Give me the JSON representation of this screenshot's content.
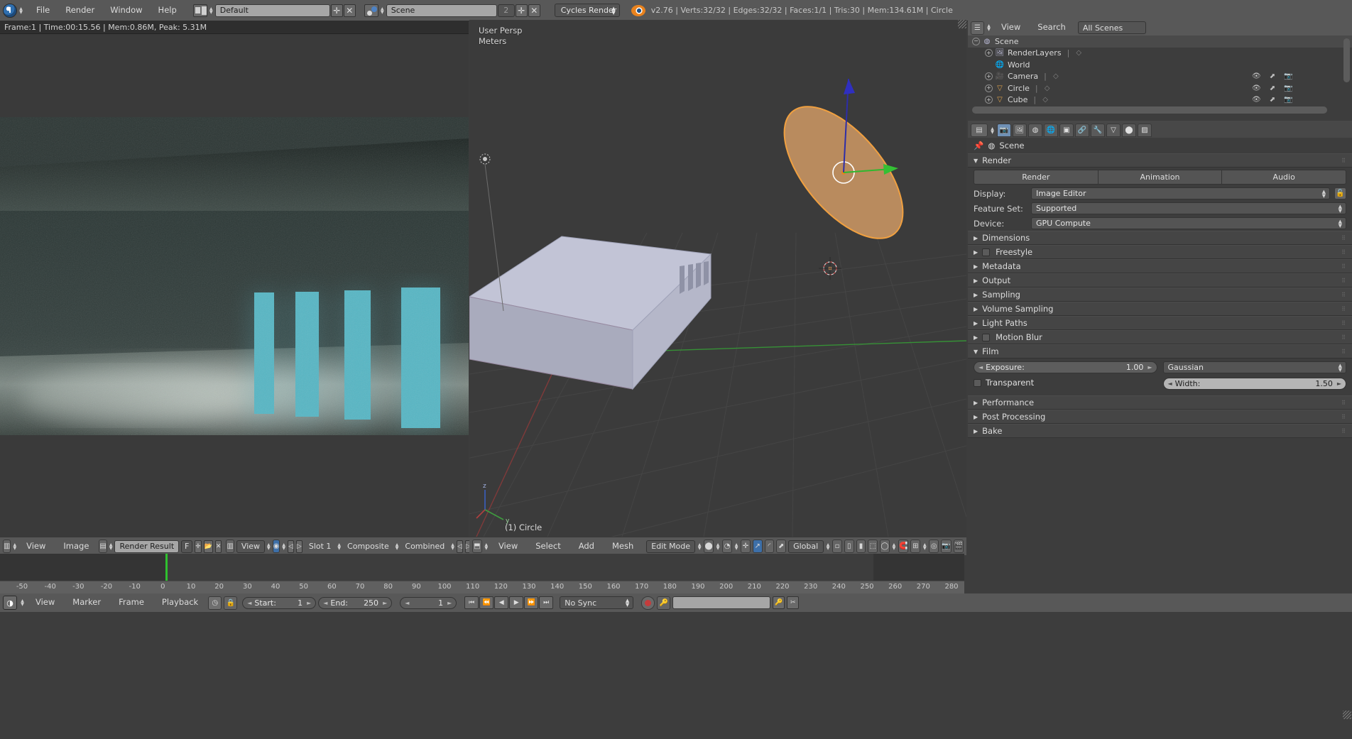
{
  "topbar": {
    "app_icon": "blender-info-icon",
    "menus": [
      "File",
      "Render",
      "Window",
      "Help"
    ],
    "screen_layout": "Default",
    "scene_name": "Scene",
    "scene_users": "2",
    "render_engine": "Cycles Render",
    "status": "v2.76 | Verts:32/32 | Edges:32/32 | Faces:1/1 | Tris:30 | Mem:134.61M | Circle"
  },
  "info_editor": {
    "report": "Frame:1 | Time:00:15.56 | Mem:0.86M, Peak: 5.31M"
  },
  "viewport": {
    "view_name": "User Persp",
    "unit": "Meters",
    "active_object": "(1) Circle",
    "axis_x": "x",
    "axis_y": "y",
    "axis_z": "z"
  },
  "image_editor_header": {
    "menus": [
      "View",
      "Image"
    ],
    "image_name": "Render Result",
    "fake_user": "F",
    "add_label": "+",
    "view_menu": "View",
    "slot": "Slot 1",
    "layer": "Composite",
    "pass": "Combined"
  },
  "viewport_header": {
    "menus": [
      "View",
      "Select",
      "Add",
      "Mesh"
    ],
    "mode": "Edit Mode",
    "transform_orientation": "Global"
  },
  "outliner": {
    "menus": [
      "View",
      "Search"
    ],
    "display_mode": "All Scenes",
    "rows": [
      {
        "label": "Scene",
        "indent": 0,
        "expander": "−",
        "icon": "scene-icon",
        "selected": true,
        "has_restrict": false
      },
      {
        "label": "RenderLayers",
        "indent": 1,
        "expander": "+",
        "icon": "renderlayers-icon",
        "selected": false,
        "has_restrict": false
      },
      {
        "label": "World",
        "indent": 1,
        "expander": "",
        "icon": "world-icon",
        "selected": false,
        "has_restrict": false
      },
      {
        "label": "Camera",
        "indent": 1,
        "expander": "+",
        "icon": "camera-icon",
        "selected": false,
        "has_restrict": true
      },
      {
        "label": "Circle",
        "indent": 1,
        "expander": "+",
        "icon": "mesh-icon",
        "selected": false,
        "has_restrict": true
      },
      {
        "label": "Cube",
        "indent": 1,
        "expander": "+",
        "icon": "mesh-icon",
        "selected": false,
        "has_restrict": true
      }
    ]
  },
  "properties": {
    "tabs": [
      "render",
      "renderlayers",
      "scene",
      "world",
      "object",
      "constraints",
      "modifiers",
      "data",
      "material",
      "texture"
    ],
    "active_tab": "render",
    "breadcrumb": "Scene",
    "render_panel": {
      "title": "Render",
      "buttons": [
        "Render",
        "Animation",
        "Audio"
      ],
      "fields": [
        {
          "label": "Display:",
          "value": "Image Editor"
        },
        {
          "label": "Feature Set:",
          "value": "Supported"
        },
        {
          "label": "Device:",
          "value": "GPU Compute"
        }
      ]
    },
    "panels": [
      {
        "title": "Dimensions",
        "open": false,
        "checkbox": false
      },
      {
        "title": "Freestyle",
        "open": false,
        "checkbox": true
      },
      {
        "title": "Metadata",
        "open": false,
        "checkbox": false
      },
      {
        "title": "Output",
        "open": false,
        "checkbox": false
      },
      {
        "title": "Sampling",
        "open": false,
        "checkbox": false
      },
      {
        "title": "Volume Sampling",
        "open": false,
        "checkbox": false
      },
      {
        "title": "Light Paths",
        "open": false,
        "checkbox": false
      },
      {
        "title": "Motion Blur",
        "open": false,
        "checkbox": true
      }
    ],
    "film_panel": {
      "title": "Film",
      "exposure_label": "Exposure:",
      "exposure_value": "1.00",
      "transparent_label": "Transparent",
      "filter_type": "Gaussian",
      "width_label": "Width:",
      "width_value": "1.50"
    },
    "trailing_panels": [
      {
        "title": "Performance"
      },
      {
        "title": "Post Processing"
      },
      {
        "title": "Bake"
      }
    ]
  },
  "timeline": {
    "menus": [
      "View",
      "Marker",
      "Frame",
      "Playback"
    ],
    "start_label": "Start:",
    "start_value": "1",
    "end_label": "End:",
    "end_value": "250",
    "current_frame": "1",
    "sync_mode": "No Sync",
    "ticks": [
      "-50",
      "-40",
      "-30",
      "-20",
      "-10",
      "0",
      "10",
      "20",
      "30",
      "40",
      "50",
      "60",
      "70",
      "80",
      "90",
      "100",
      "110",
      "120",
      "130",
      "140",
      "150",
      "160",
      "170",
      "180",
      "190",
      "200",
      "210",
      "220",
      "230",
      "240",
      "250",
      "260",
      "270",
      "280"
    ]
  },
  "colors": {
    "header": "#585858",
    "panel": "#3d3d3d",
    "accent_blue": "#6f90b5",
    "selected_orange": "#e8821e",
    "render_teal": "#57b6c4"
  }
}
